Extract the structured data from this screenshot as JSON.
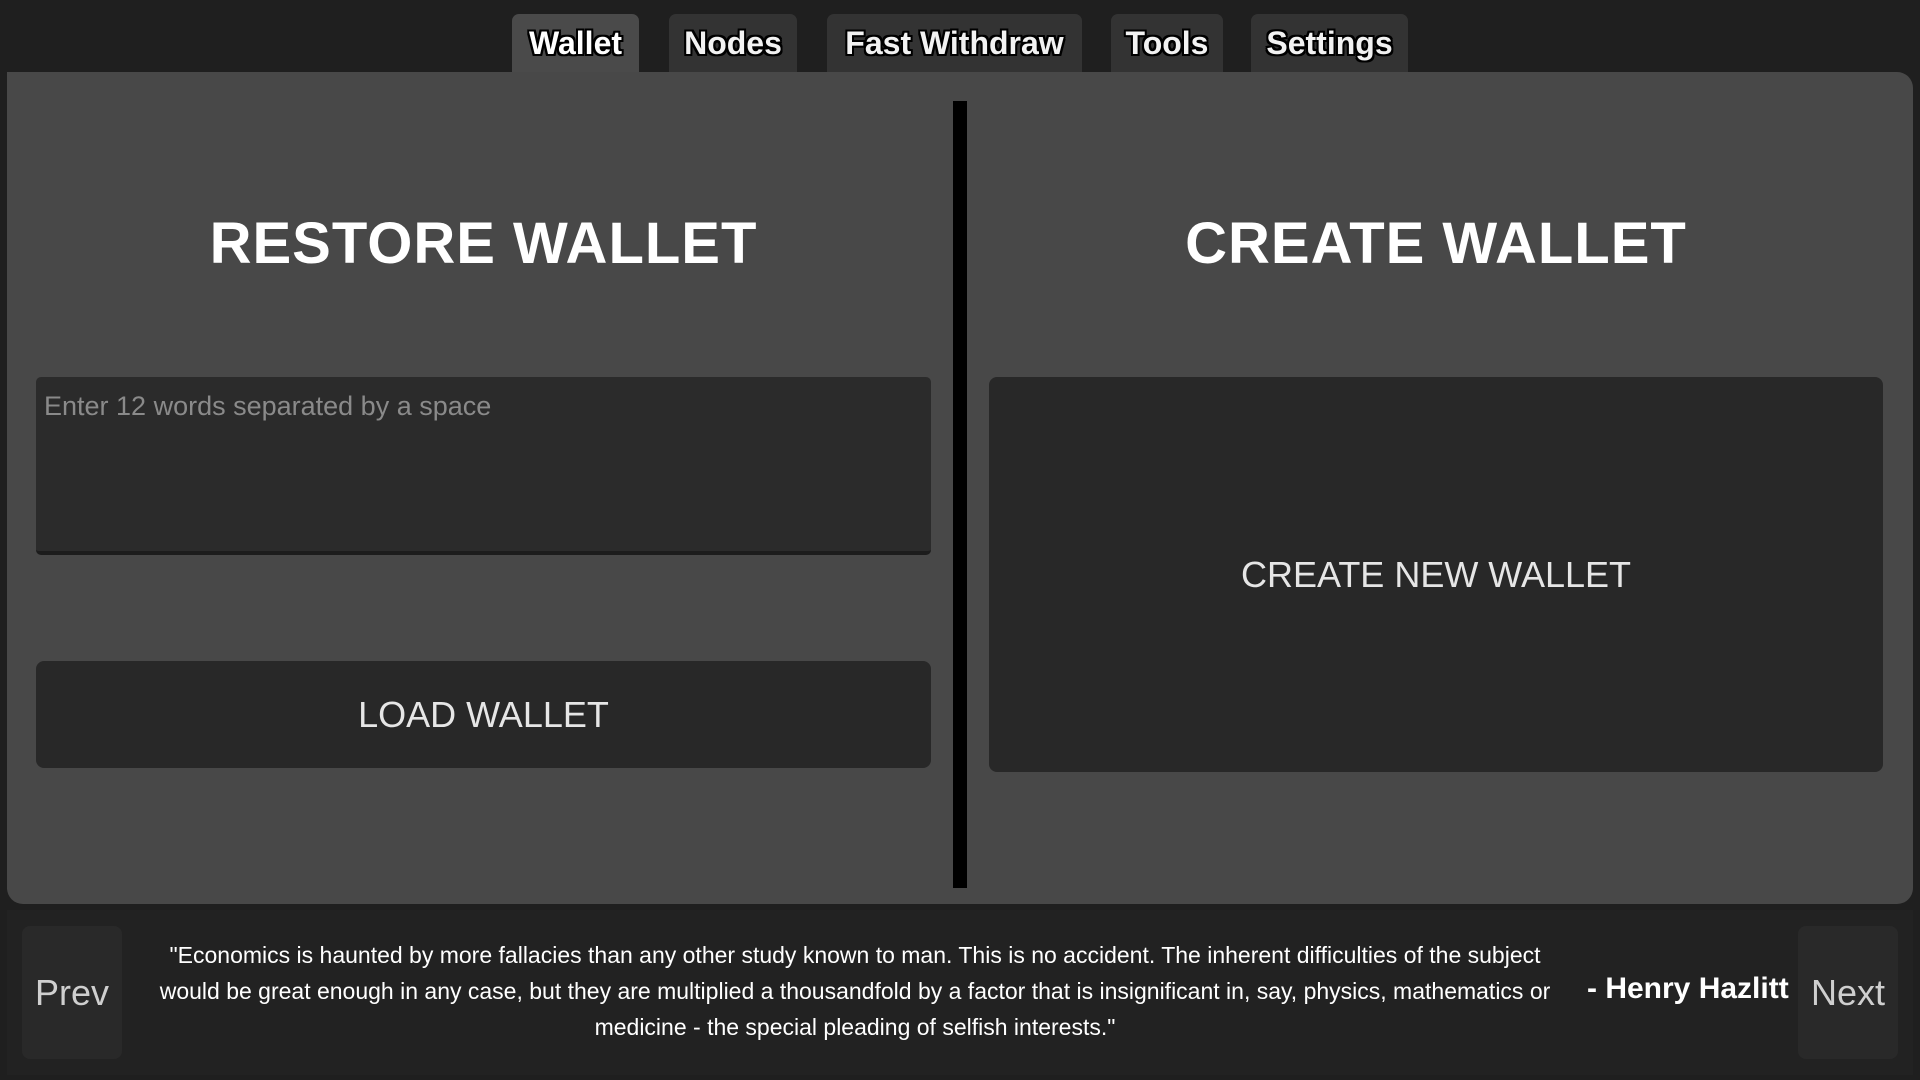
{
  "tabs": [
    {
      "label": "Wallet",
      "active": true
    },
    {
      "label": "Nodes",
      "active": false
    },
    {
      "label": "Fast Withdraw",
      "active": false
    },
    {
      "label": "Tools",
      "active": false
    },
    {
      "label": "Settings",
      "active": false
    }
  ],
  "restore": {
    "title": "RESTORE WALLET",
    "seed_placeholder": "Enter 12 words separated by a space",
    "seed_value": "",
    "load_button": "LOAD WALLET"
  },
  "create": {
    "title": "CREATE WALLET",
    "create_button": "CREATE NEW WALLET"
  },
  "quote_bar": {
    "prev_label": "Prev",
    "next_label": "Next",
    "quote": "\"Economics is haunted by more fallacies than any other study known to man. This is no accident. The inherent difficulties of the subject would be great enough in any case, but they are multiplied a thousandfold by a factor that is insignificant in, say, physics, mathematics or medicine - the special pleading of selfish interests.\"",
    "author": "- Henry Hazlitt"
  }
}
